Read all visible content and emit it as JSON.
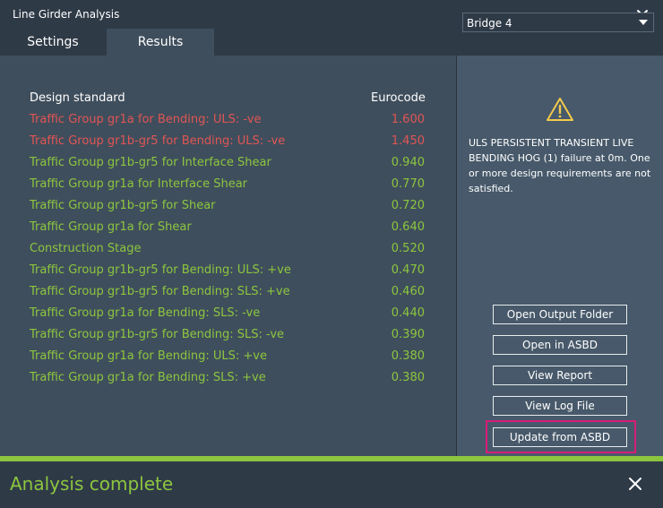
{
  "window": {
    "title": "Line Girder Analysis"
  },
  "tabs": [
    {
      "label": "Settings",
      "active": false
    },
    {
      "label": "Results",
      "active": true
    }
  ],
  "colors": {
    "fail": "#e05555",
    "pass": "#8cc63f",
    "accent": "#8cc63f",
    "warning": "#f2c94c",
    "highlight": "#d81b7a"
  },
  "table": {
    "header_name": "Design standard",
    "header_value": "Eurocode",
    "rows": [
      {
        "name": "Traffic Group gr1a for Bending: ULS: -ve",
        "value": "1.600",
        "status": "fail"
      },
      {
        "name": "Traffic Group gr1b-gr5 for Bending: ULS: -ve",
        "value": "1.450",
        "status": "fail"
      },
      {
        "name": "Traffic Group gr1b-gr5 for Interface Shear",
        "value": "0.940",
        "status": "pass"
      },
      {
        "name": "Traffic Group gr1a for Interface Shear",
        "value": "0.770",
        "status": "pass"
      },
      {
        "name": "Traffic Group gr1b-gr5 for Shear",
        "value": "0.720",
        "status": "pass"
      },
      {
        "name": "Traffic Group gr1a for Shear",
        "value": "0.640",
        "status": "pass"
      },
      {
        "name": "Construction Stage",
        "value": "0.520",
        "status": "pass"
      },
      {
        "name": "Traffic Group gr1b-gr5 for Bending: ULS: +ve",
        "value": "0.470",
        "status": "pass"
      },
      {
        "name": "Traffic Group gr1b-gr5 for Bending: SLS: +ve",
        "value": "0.460",
        "status": "pass"
      },
      {
        "name": "Traffic Group gr1a for Bending: SLS: -ve",
        "value": "0.440",
        "status": "pass"
      },
      {
        "name": "Traffic Group gr1b-gr5 for Bending: SLS: -ve",
        "value": "0.390",
        "status": "pass"
      },
      {
        "name": "Traffic Group gr1a for Bending: ULS: +ve",
        "value": "0.380",
        "status": "pass"
      },
      {
        "name": "Traffic Group gr1a for Bending: SLS: +ve",
        "value": "0.380",
        "status": "pass"
      }
    ]
  },
  "sidebar": {
    "bridge_select": "Bridge 4",
    "warning_icon": "warning-triangle-icon",
    "message": "ULS PERSISTENT TRANSIENT LIVE BENDING HOG (1) failure at 0m. One or more design requirements are not satisfied.",
    "buttons": {
      "open_output_folder": "Open Output Folder",
      "open_in_asbd": "Open in ASBD",
      "view_report": "View Report",
      "view_log_file": "View Log File",
      "update_from_asbd": "Update from ASBD"
    }
  },
  "status": {
    "text": "Analysis complete"
  }
}
